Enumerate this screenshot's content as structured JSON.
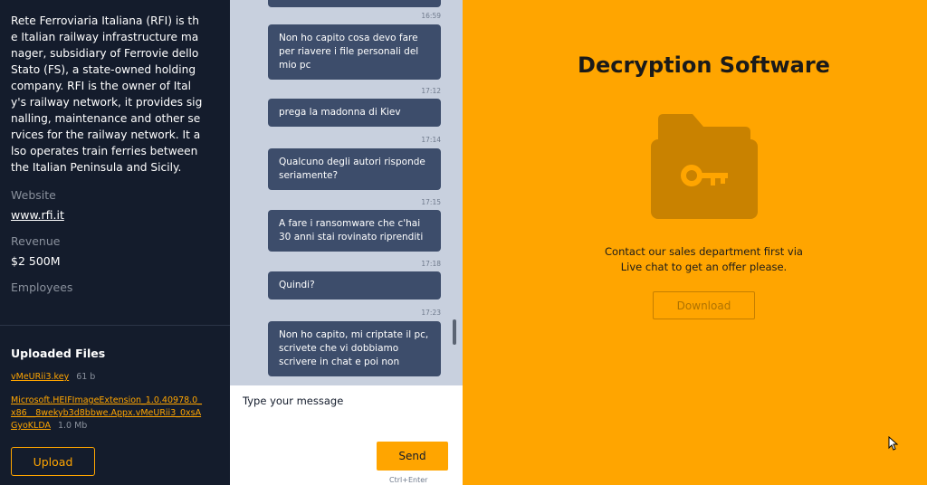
{
  "sidebar": {
    "description": "Rete Ferroviaria Italiana (RFI) is the Italian railway infrastructure manager, subsidiary of Ferrovie dello Stato (FS), a state-owned holding company. RFI is the owner of Italy's railway network, it provides signalling, maintenance and other services for the railway network. It also operates train ferries between the Italian Peninsula and Sicily.",
    "website_label": "Website",
    "website_value": "www.rfi.it",
    "revenue_label": "Revenue",
    "revenue_value": "$2 500M",
    "employees_label": "Employees",
    "files_title": "Uploaded Files",
    "files": [
      {
        "name": "vMeURii3.key",
        "size": "61 b"
      },
      {
        "name": "Microsoft.HEIFImageExtension_1.0.40978.0_x86__8wekyb3d8bbwe.Appx.vMeURii3_0xsAGyoKLDA",
        "size": "1.0 Mb"
      }
    ],
    "upload_label": "Upload"
  },
  "chat": {
    "first_time": "16:59",
    "messages": [
      {
        "text": "Non ho capito cosa devo fare per riavere i file personali del mio pc",
        "time": "17:12"
      },
      {
        "text": "prega la madonna di Kiev",
        "time": "17:14"
      },
      {
        "text": "Qualcuno degli autori risponde seriamente?",
        "time": "17:15"
      },
      {
        "text": "A fare i ransomware che c'hai 30 anni stai rovinato riprenditi",
        "time": "17:18"
      },
      {
        "text": "Quindi?",
        "time": "17:23"
      },
      {
        "text": "Non ho capito, mi criptate il pc, scrivete che vi dobbiamo scrivere in chat e poi non",
        "time": ""
      }
    ],
    "input_placeholder": "Type your message",
    "send_label": "Send",
    "send_hint": "Ctrl+Enter"
  },
  "right": {
    "title": "Decryption Software",
    "offer_line1": "Contact our sales department first via",
    "offer_line2": "Live chat to get an offer please.",
    "download_label": "Download"
  },
  "colors": {
    "accent": "#ffa500",
    "sidebar_bg": "#141c2c",
    "bubble_bg": "#3d4d6b",
    "chat_bg": "#c8d0de",
    "folder": "#c98200"
  },
  "icons": [
    "folder-key-icon",
    "mouse-cursor-icon"
  ]
}
